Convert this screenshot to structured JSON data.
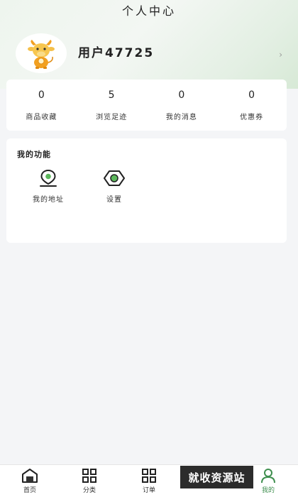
{
  "header": {
    "title": "个人中心"
  },
  "profile": {
    "username": "用户47725",
    "chevron": "›",
    "avatar_icon": "cow-mascot-icon"
  },
  "stats": [
    {
      "value": "0",
      "label": "商品收藏"
    },
    {
      "value": "5",
      "label": "浏览足迹"
    },
    {
      "value": "0",
      "label": "我的消息"
    },
    {
      "value": "0",
      "label": "优惠券"
    }
  ],
  "functions": {
    "title": "我的功能",
    "items": [
      {
        "label": "我的地址",
        "icon": "location-pin-icon"
      },
      {
        "label": "设置",
        "icon": "settings-icon"
      }
    ]
  },
  "tabbar": {
    "tabs": [
      {
        "label": "首页",
        "icon": "home-icon"
      },
      {
        "label": "分类",
        "icon": "grid-icon"
      },
      {
        "label": "订单",
        "icon": "grid-icon"
      },
      {
        "label": "",
        "icon": "cart-icon"
      },
      {
        "label": "我的",
        "icon": "user-icon"
      }
    ],
    "active_index": 4,
    "active_color": "#3f8f4f"
  },
  "watermark": {
    "text": "就收资源站"
  }
}
